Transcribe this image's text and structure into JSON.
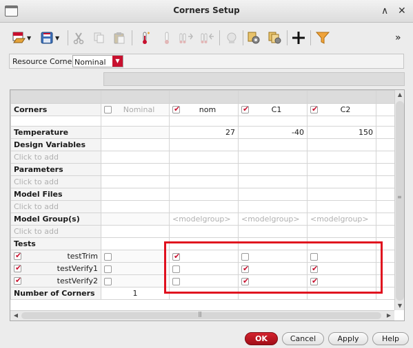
{
  "window": {
    "title": "Corners Setup",
    "expand_glyph": "∧",
    "close_glyph": "✕"
  },
  "toolbar": {
    "icons": [
      "open-csv-icon",
      "save-csv-icon",
      "cut-icon",
      "copy-icon",
      "paste-icon",
      "add-temperature-icon",
      "add-variable-icon",
      "add-parameter-icon",
      "add-model-file-icon",
      "add-group-icon",
      "corner-settings-icon",
      "corner-copy-icon",
      "add-corner-icon",
      "filter-icon"
    ],
    "overflow": "»"
  },
  "resource_corner": {
    "label": "Resource Corner",
    "value": "Nominal"
  },
  "grid": {
    "corners_label": "Corners",
    "columns": [
      {
        "name": "Nominal",
        "checked": false,
        "disabled": true
      },
      {
        "name": "nom",
        "checked": true
      },
      {
        "name": "C1",
        "checked": true
      },
      {
        "name": "C2",
        "checked": true
      }
    ],
    "temperature": {
      "label": "Temperature",
      "values": [
        "27",
        "-40",
        "150"
      ]
    },
    "design_variables": {
      "label": "Design Variables",
      "placeholder": "Click to add"
    },
    "parameters": {
      "label": "Parameters",
      "placeholder": "Click to add"
    },
    "model_files": {
      "label": "Model Files",
      "placeholder": "Click to add"
    },
    "model_groups": {
      "label": "Model Group(s)",
      "placeholder": "Click to add",
      "cell_placeholder": "<modelgroup>"
    },
    "tests_label": "Tests",
    "tests": [
      {
        "name": "testTrim",
        "enabled": true,
        "nominal": false,
        "corners": [
          true,
          false,
          false
        ]
      },
      {
        "name": "testVerify1",
        "enabled": true,
        "nominal": false,
        "corners": [
          false,
          true,
          true
        ]
      },
      {
        "name": "testVerify2",
        "enabled": true,
        "nominal": false,
        "corners": [
          false,
          true,
          true
        ]
      }
    ],
    "number_of_corners": {
      "label": "Number of Corners",
      "value": "1"
    }
  },
  "buttons": {
    "ok": "OK",
    "cancel": "Cancel",
    "apply": "Apply",
    "help": "Help"
  },
  "colors": {
    "accent": "#c8102e",
    "highlight_box": "#e0101e"
  }
}
